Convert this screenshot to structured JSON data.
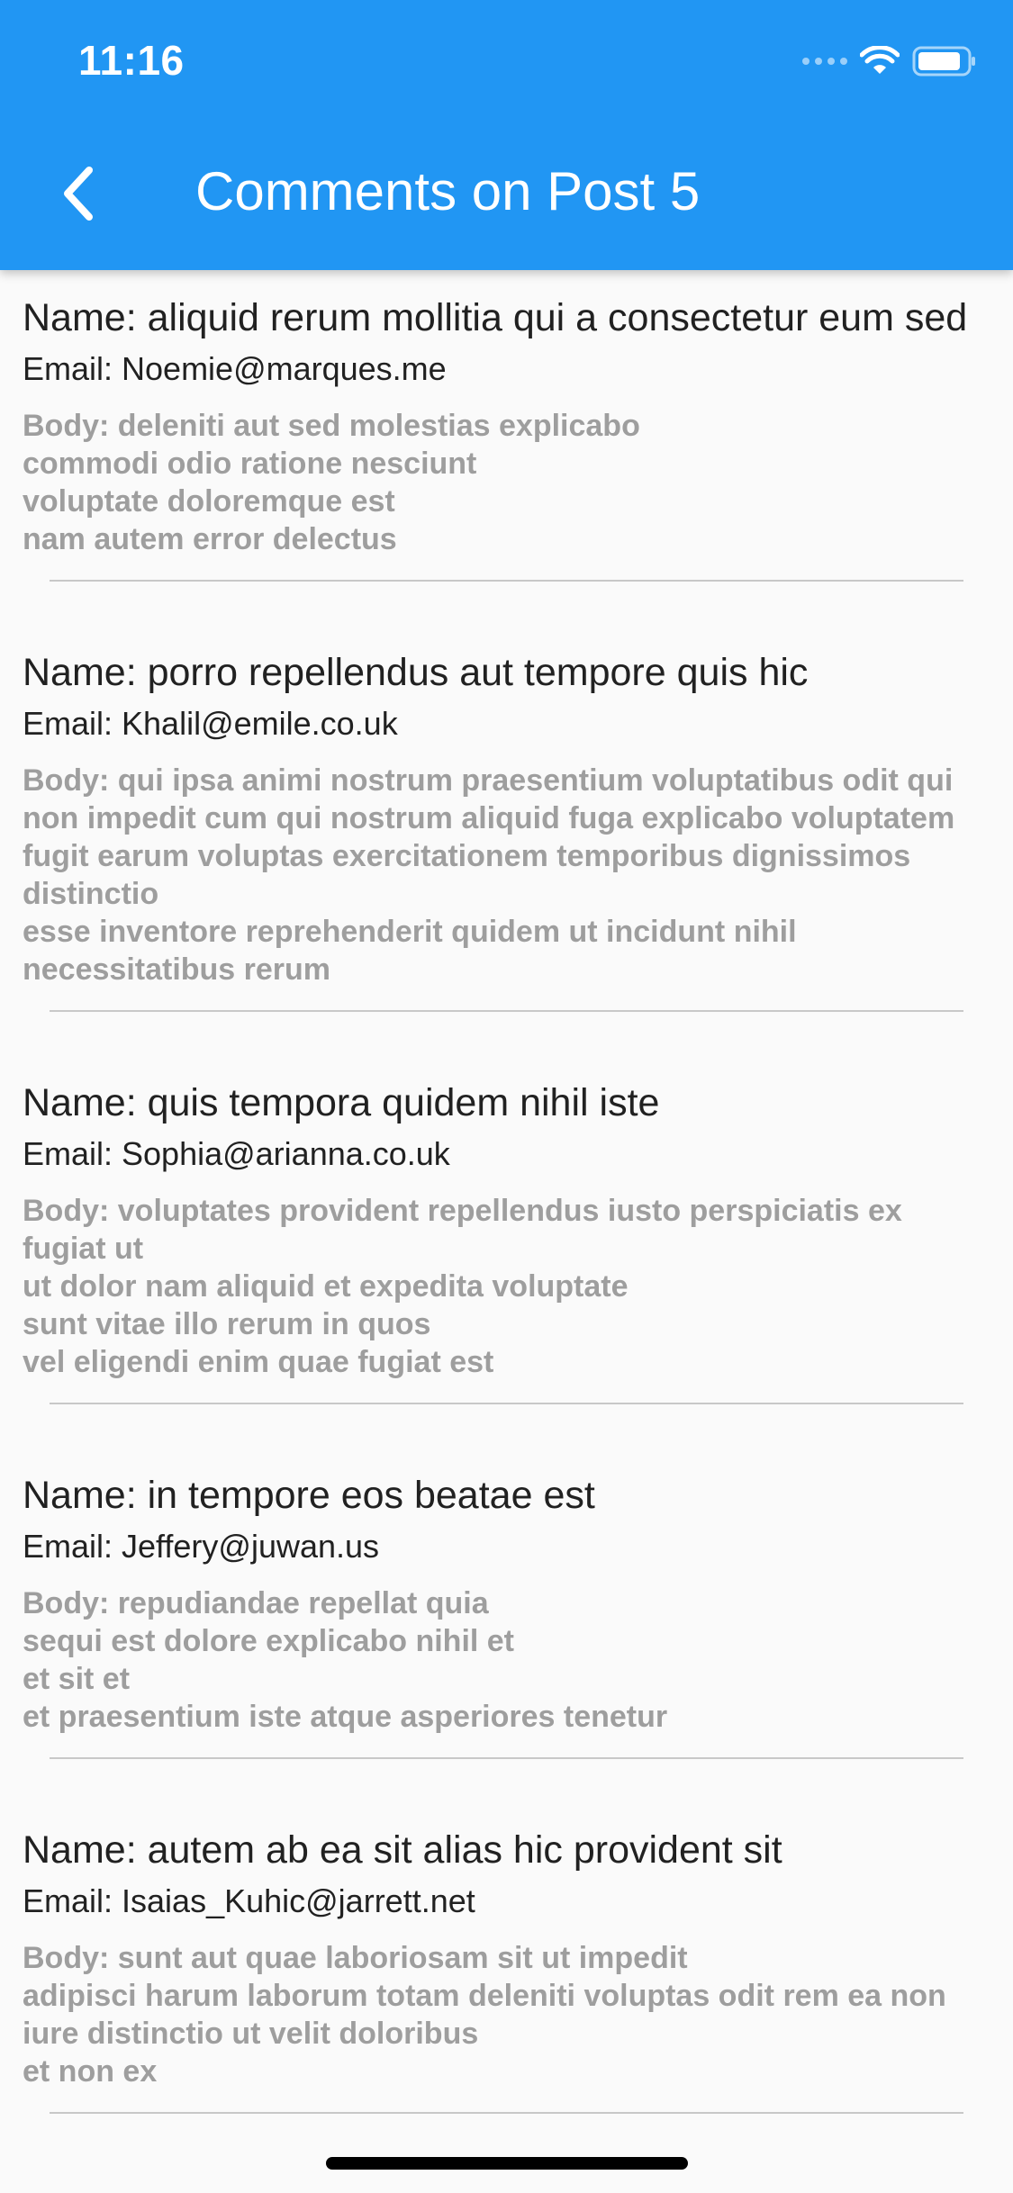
{
  "status_bar": {
    "time": "11:16"
  },
  "app_bar": {
    "title": "Comments on Post 5",
    "back_icon": "chevron-left-icon",
    "color": "#2196f3"
  },
  "comments": [
    {
      "name": "Name: aliquid rerum mollitia qui a consectetur eum sed",
      "email": "Email: Noemie@marques.me",
      "body": "Body: deleniti aut sed molestias explicabo\ncommodi odio ratione nesciunt\nvoluptate doloremque est\nnam autem error delectus"
    },
    {
      "name": "Name: porro repellendus aut tempore quis hic",
      "email": "Email: Khalil@emile.co.uk",
      "body": "Body: qui ipsa animi nostrum praesentium voluptatibus odit qui non impedit cum qui nostrum aliquid fuga explicabo voluptatem fugit earum voluptas exercitationem temporibus dignissimos distinctio\nesse inventore reprehenderit quidem ut incidunt nihil necessitatibus rerum"
    },
    {
      "name": "Name: quis tempora quidem nihil iste",
      "email": "Email: Sophia@arianna.co.uk",
      "body": "Body: voluptates provident repellendus iusto perspiciatis ex fugiat ut\nut dolor nam aliquid et expedita voluptate\nsunt vitae illo rerum in quos\nvel eligendi enim quae fugiat est"
    },
    {
      "name": "Name: in tempore eos beatae est",
      "email": "Email: Jeffery@juwan.us",
      "body": "Body: repudiandae repellat quia\nsequi est dolore explicabo nihil et\net sit et\net praesentium iste atque asperiores tenetur"
    },
    {
      "name": "Name: autem ab ea sit alias hic provident sit",
      "email": "Email: Isaias_Kuhic@jarrett.net",
      "body": "Body: sunt aut quae laboriosam sit ut impedit\nadipisci harum laborum totam deleniti voluptas odit rem ea non iure distinctio ut velit doloribus\net non ex"
    }
  ]
}
